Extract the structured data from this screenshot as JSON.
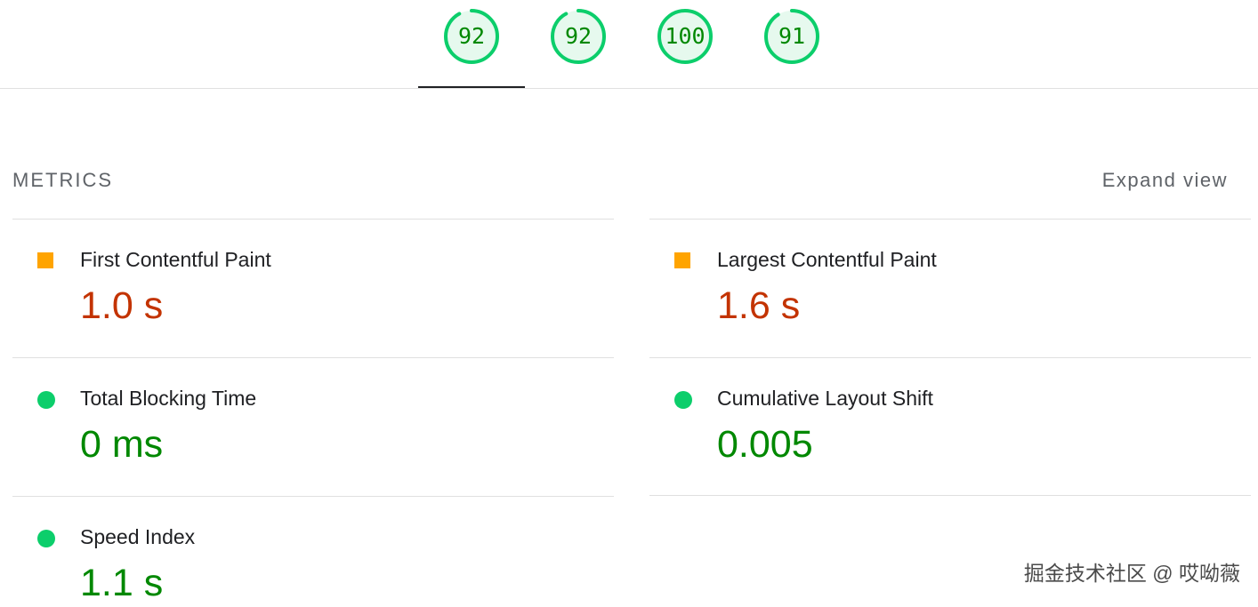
{
  "gauges": [
    {
      "label": "92",
      "score": 92,
      "color": "#0cce6b",
      "active": true
    },
    {
      "label": "92",
      "score": 92,
      "color": "#0cce6b",
      "active": false
    },
    {
      "label": "100",
      "score": 100,
      "color": "#0cce6b",
      "active": false
    },
    {
      "label": "91",
      "score": 91,
      "color": "#0cce6b",
      "active": false
    }
  ],
  "metrics_section": {
    "title": "METRICS",
    "expand_label": "Expand view"
  },
  "metrics": [
    {
      "label": "First Contentful Paint",
      "value": "1.0 s",
      "rating": "average",
      "indicator": "orange-square-icon"
    },
    {
      "label": "Largest Contentful Paint",
      "value": "1.6 s",
      "rating": "average",
      "indicator": "orange-square-icon"
    },
    {
      "label": "Total Blocking Time",
      "value": "0 ms",
      "rating": "pass",
      "indicator": "green-circle-icon"
    },
    {
      "label": "Cumulative Layout Shift",
      "value": "0.005",
      "rating": "pass",
      "indicator": "green-circle-icon"
    },
    {
      "label": "Speed Index",
      "value": "1.1 s",
      "rating": "pass",
      "indicator": "green-circle-icon"
    }
  ],
  "colors": {
    "pass": "#008800",
    "average": "#c33300",
    "pass_indicator": "#0cce6b",
    "average_indicator": "#ffa400",
    "gauge_fill": "#e6f9ee"
  },
  "watermark": "掘金技术社区 @ 哎呦薇"
}
